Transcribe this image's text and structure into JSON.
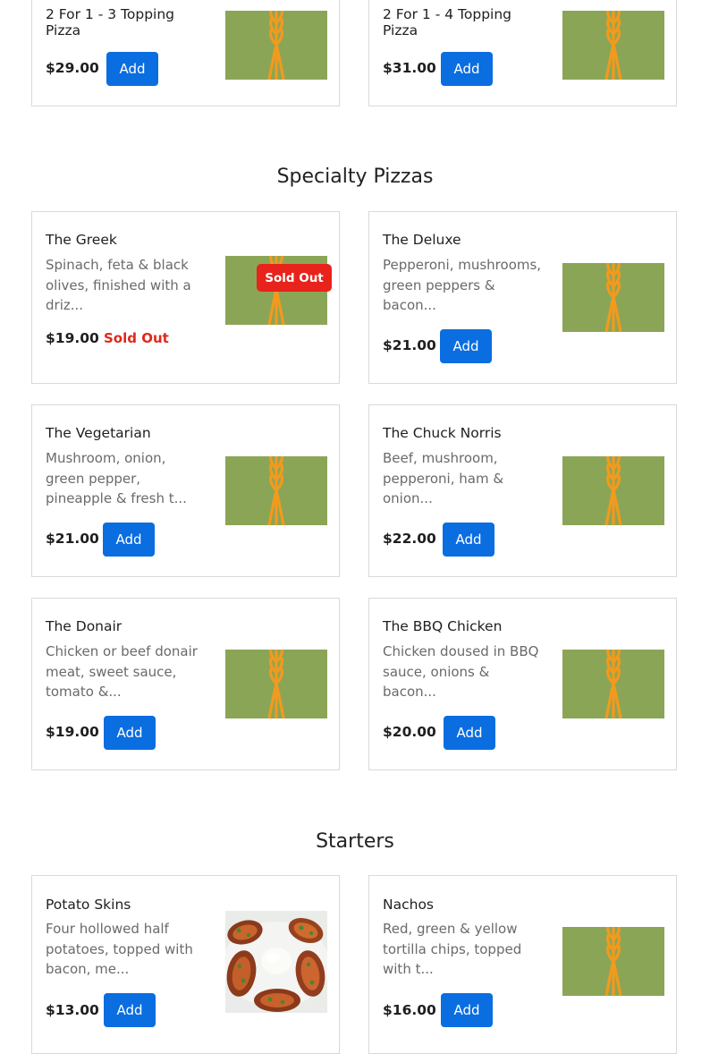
{
  "sections": {
    "specialty_title": "Specialty Pizzas",
    "starters_title": "Starters"
  },
  "top_items": [
    {
      "name": "2 For 1 - 3 Topping Pizza",
      "price": "$29.00",
      "button": "Add"
    },
    {
      "name": "2 For 1 - 4 Topping Pizza",
      "price": "$31.00",
      "button": "Add"
    }
  ],
  "specialty_items": [
    {
      "name": "The Greek",
      "desc": "Spinach, feta & black olives, finished with a driz...",
      "price": "$19.00",
      "status": "Sold Out",
      "badge": "Sold Out"
    },
    {
      "name": "The Deluxe",
      "desc": "Pepperoni, mushrooms, green peppers & bacon...",
      "price": "$21.00",
      "button": "Add"
    },
    {
      "name": "The Vegetarian",
      "desc": "Mushroom, onion, green pepper, pineapple & fresh t...",
      "price": "$21.00",
      "button": "Add"
    },
    {
      "name": "The Chuck Norris",
      "desc": "Beef, mushroom, pepperoni, ham & onion...",
      "price": "$22.00",
      "button": "Add"
    },
    {
      "name": "The Donair",
      "desc": "Chicken or beef donair meat, sweet sauce, tomato &...",
      "price": "$19.00",
      "button": "Add"
    },
    {
      "name": "The BBQ Chicken",
      "desc": "Chicken doused in BBQ sauce, onions & bacon...",
      "price": "$20.00",
      "button": "Add"
    }
  ],
  "starter_items": [
    {
      "name": "Potato Skins",
      "desc": "Four hollowed half potatoes, topped with bacon, me...",
      "price": "$13.00",
      "button": "Add"
    },
    {
      "name": "Nachos",
      "desc": "Red, green & yellow tortilla chips, topped with t...",
      "price": "$16.00",
      "button": "Add"
    }
  ],
  "icons": {
    "placeholder": "wheat-icon",
    "photo": "potato-skins-photo"
  },
  "colors": {
    "button": "#0a6de0",
    "placeholder_bg": "#8ba556",
    "wheat": "#f29a1e",
    "sold_out": "#e0291a"
  }
}
